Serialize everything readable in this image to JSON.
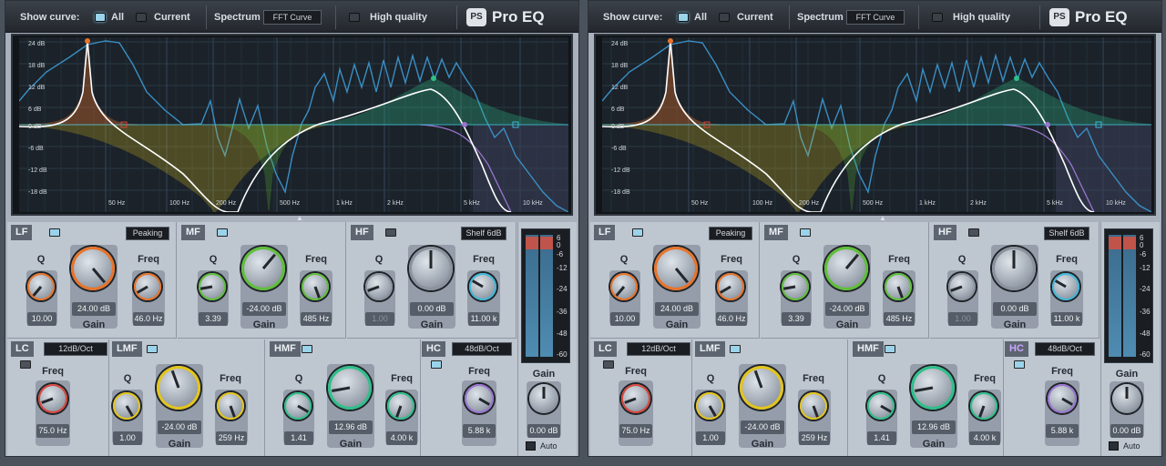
{
  "plugins": [
    {
      "toolbar": {
        "show_curve_label": "Show curve:",
        "all_label": "All",
        "current_label": "Current",
        "spectrum_label": "Spectrum",
        "spectrum_value": "FFT Curve",
        "high_quality_label": "High quality",
        "all_on": true,
        "current_on": false,
        "hq_on": false
      },
      "logo": "Pro EQ",
      "graph": {
        "db_labels": [
          "24 dB",
          "18 dB",
          "12 dB",
          "6 dB",
          "0 dB",
          "-6 dB",
          "-12 dB",
          "-18 dB"
        ],
        "freq_labels": [
          "50 Hz",
          "100 Hz",
          "200 Hz",
          "500 Hz",
          "1 kHz",
          "2 kHz",
          "5 kHz",
          "10 kHz"
        ]
      },
      "lf": {
        "label": "LF",
        "mode": "Peaking",
        "q_label": "Q",
        "q_value": "10.00",
        "gain_value": "24.00 dB",
        "gain_label": "Gain",
        "freq_label": "Freq",
        "freq_value": "46.0 Hz"
      },
      "mf": {
        "label": "MF",
        "q_label": "Q",
        "q_value": "3.39",
        "gain_value": "-24.00 dB",
        "gain_label": "Gain",
        "freq_label": "Freq",
        "freq_value": "485 Hz"
      },
      "hf": {
        "label": "HF",
        "mode": "Shelf 6dB",
        "q_label": "Q",
        "q_value": "1.00",
        "gain_value": "0.00 dB",
        "gain_label": "Gain",
        "freq_label": "Freq",
        "freq_value": "11.00 k"
      },
      "lc": {
        "label": "LC",
        "slope": "12dB/Oct",
        "freq_label": "Freq",
        "freq_value": "75.0 Hz"
      },
      "lmf": {
        "label": "LMF",
        "q_label": "Q",
        "q_value": "1.00",
        "gain_value": "-24.00 dB",
        "gain_label": "Gain",
        "freq_label": "Freq",
        "freq_value": "259 Hz"
      },
      "hmf": {
        "label": "HMF",
        "q_label": "Q",
        "q_value": "1.41",
        "gain_value": "12.96 dB",
        "gain_label": "Gain",
        "freq_label": "Freq",
        "freq_value": "4.00 k"
      },
      "hc": {
        "label": "HC",
        "slope": "48dB/Oct",
        "freq_label": "Freq",
        "freq_value": "5.88 k"
      },
      "output": {
        "meter_scale": [
          "6",
          "0",
          "-6",
          "-12",
          "-24",
          "-36",
          "-48",
          "-60"
        ],
        "gain_label": "Gain",
        "gain_value": "0.00 dB",
        "auto_label": "Auto"
      }
    },
    {
      "toolbar": {
        "show_curve_label": "Show curve:",
        "all_label": "All",
        "current_label": "Current",
        "spectrum_label": "Spectrum",
        "spectrum_value": "FFT Curve",
        "high_quality_label": "High quality",
        "all_on": true,
        "current_on": false,
        "hq_on": false
      },
      "logo": "Pro EQ",
      "graph": {
        "db_labels": [
          "24 dB",
          "18 dB",
          "12 dB",
          "6 dB",
          "0 dB",
          "-6 dB",
          "-12 dB",
          "-18 dB"
        ],
        "freq_labels": [
          "50 Hz",
          "100 Hz",
          "200 Hz",
          "500 Hz",
          "1 kHz",
          "2 kHz",
          "5 kHz",
          "10 kHz"
        ]
      },
      "lf": {
        "label": "LF",
        "mode": "Peaking",
        "q_label": "Q",
        "q_value": "10.00",
        "gain_value": "24.00 dB",
        "gain_label": "Gain",
        "freq_label": "Freq",
        "freq_value": "46.0 Hz"
      },
      "mf": {
        "label": "MF",
        "q_label": "Q",
        "q_value": "3.39",
        "gain_value": "-24.00 dB",
        "gain_label": "Gain",
        "freq_label": "Freq",
        "freq_value": "485 Hz"
      },
      "hf": {
        "label": "HF",
        "mode": "Shelf 6dB",
        "q_label": "Q",
        "q_value": "1.00",
        "gain_value": "0.00 dB",
        "gain_label": "Gain",
        "freq_label": "Freq",
        "freq_value": "11.00 k"
      },
      "lc": {
        "label": "LC",
        "slope": "12dB/Oct",
        "freq_label": "Freq",
        "freq_value": "75.0 Hz"
      },
      "lmf": {
        "label": "LMF",
        "q_label": "Q",
        "q_value": "1.00",
        "gain_value": "-24.00 dB",
        "gain_label": "Gain",
        "freq_label": "Freq",
        "freq_value": "259 Hz"
      },
      "hmf": {
        "label": "HMF",
        "q_label": "Q",
        "q_value": "1.41",
        "gain_value": "12.96 dB",
        "gain_label": "Gain",
        "freq_label": "Freq",
        "freq_value": "4.00 k"
      },
      "hc": {
        "label": "HC",
        "slope": "48dB/Oct",
        "freq_label": "Freq",
        "freq_value": "5.88 k"
      },
      "output": {
        "meter_scale": [
          "6",
          "0",
          "-6",
          "-12",
          "-24",
          "-36",
          "-48",
          "-60"
        ],
        "gain_label": "Gain",
        "gain_value": "0.00 dB",
        "auto_label": "Auto"
      }
    }
  ],
  "colors": {
    "lf": "#e8742a",
    "mf": "#5fbf3a",
    "hf": "#3fb8d8",
    "lc": "#d8463c",
    "lmf": "#e3c41c",
    "hmf": "#2fbf8a",
    "hc": "#9a74d0",
    "spectrum": "#3a8ec4",
    "curve": "#ffffff"
  },
  "icons": {
    "logo_mark": "presonus-logo-icon",
    "graph_tab": "triangle-up-icon"
  }
}
